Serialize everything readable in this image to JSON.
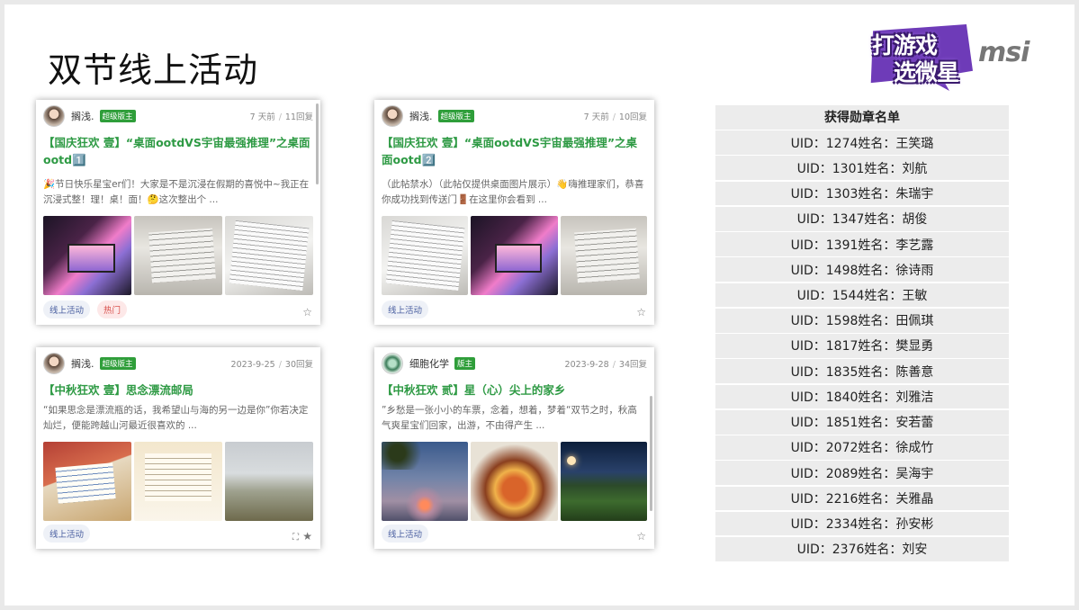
{
  "slide": {
    "title": "双节线上活动"
  },
  "logos": {
    "game_line1": "打游戏",
    "game_line2": "选微星",
    "brand": "msi"
  },
  "cards": [
    {
      "username": "搁浅.",
      "role": "超级版主",
      "time": "7 天前",
      "replies": "11回复",
      "title": "【国庆狂欢 壹】“桌面ootdVS宇宙最强推理”之桌面ootd1️⃣",
      "excerpt": "🎉节日快乐星宝er们！大家是不是沉浸在假期的喜悦中~我正在沉浸式整！理！桌！面！🤔这次整出个 ...",
      "tags": [
        "线上活动",
        "热门"
      ]
    },
    {
      "username": "搁浅.",
      "role": "超级版主",
      "time": "7 天前",
      "replies": "10回复",
      "title": "【国庆狂欢 壹】“桌面ootdVS宇宙最强推理”之桌面ootd2️⃣",
      "excerpt": "（此帖禁水）（此帖仅提供桌面图片展示）👋嗨推理家们，恭喜你成功找到传送门🚪在这里你会看到 ...",
      "tags": [
        "线上活动"
      ]
    },
    {
      "username": "搁浅.",
      "role": "超级版主",
      "time": "2023-9-25",
      "replies": "30回复",
      "title": "【中秋狂欢 壹】思念漂流邮局",
      "excerpt": "“如果思念是漂流瓶的话，我希望山与海的另一边是你”你若决定灿烂，便能跨越山河最近很喜欢的 ...",
      "tags": [
        "线上活动"
      ]
    },
    {
      "username": "细胞化学",
      "role": "版主",
      "time": "2023-9-28",
      "replies": "34回复",
      "title": "【中秋狂欢 贰】星（心）尖上的家乡",
      "excerpt": "”乡愁是一张小小的车票，念着，想着，梦着“双节之时，秋高气爽星宝们回家，出游，不由得产生 ...",
      "tags": [
        "线上活动"
      ]
    }
  ],
  "award_list": {
    "header": "获得勋章名单",
    "rows": [
      "UID：1274姓名：王笑璐",
      "UID：1301姓名：刘航",
      "UID：1303姓名：朱瑞宇",
      "UID：1347姓名：胡俊",
      "UID：1391姓名：李艺露",
      "UID：1498姓名：徐诗雨",
      "UID：1544姓名：王敏",
      "UID：1598姓名：田佩琪",
      "UID：1817姓名：樊显勇",
      "UID：1835姓名：陈善意",
      "UID：1840姓名：刘雅洁",
      "UID：1851姓名：安若蕾",
      "UID：2072姓名：徐成竹",
      "UID：2089姓名：吴海宇",
      "UID：2216姓名：关雅晶",
      "UID：2334姓名：孙安彬",
      "UID：2376姓名：刘安"
    ]
  }
}
